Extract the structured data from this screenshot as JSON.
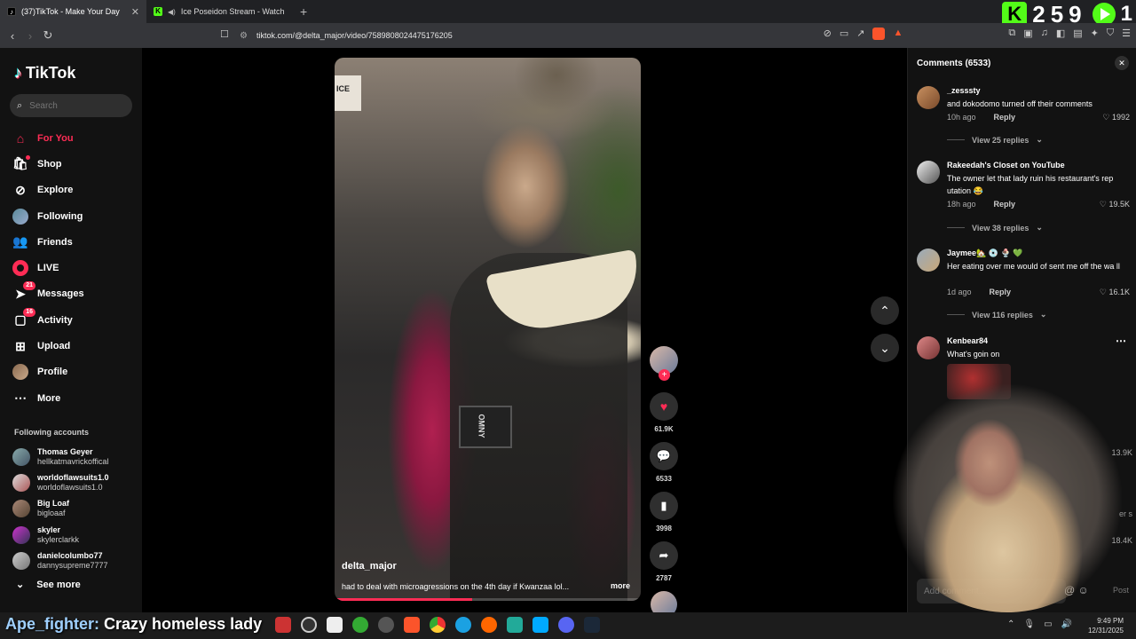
{
  "browser": {
    "tabs": [
      {
        "title": "(37)TikTok - Make Your Day",
        "favicon": "tiktok-icon",
        "active": true
      },
      {
        "title": "Ice Poseidon Stream - Watch Live",
        "favicon": "kick-icon",
        "active": false
      }
    ],
    "url": "tiktok.com/@delta_major/video/7589808024475176205"
  },
  "kick_overlay": {
    "number": "259",
    "viewers": "1"
  },
  "sidebar": {
    "logo": "TikTok",
    "search_placeholder": "Search",
    "items": [
      {
        "label": "For You",
        "icon": "home-icon",
        "active": true
      },
      {
        "label": "Shop",
        "icon": "shop-bag-icon"
      },
      {
        "label": "Explore",
        "icon": "compass-icon"
      },
      {
        "label": "Following",
        "icon": "following-avatar-icon"
      },
      {
        "label": "Friends",
        "icon": "friends-icon"
      },
      {
        "label": "LIVE",
        "icon": "live-icon"
      },
      {
        "label": "Messages",
        "icon": "paper-plane-icon",
        "badge": "21"
      },
      {
        "label": "Activity",
        "icon": "activity-icon",
        "badge": "16"
      },
      {
        "label": "Upload",
        "icon": "upload-icon"
      },
      {
        "label": "Profile",
        "icon": "profile-avatar-icon"
      },
      {
        "label": "More",
        "icon": "more-icon"
      }
    ],
    "following_header": "Following accounts",
    "following": [
      {
        "name": "Thomas Geyer",
        "handle": "hellkatmavrickoffical"
      },
      {
        "name": "worldoflawsuits1.0",
        "handle": "worldoflawsuits1.0"
      },
      {
        "name": "Big Loaf",
        "handle": "bigloaaf"
      },
      {
        "name": "skyler",
        "handle": "skylerclarkk"
      },
      {
        "name": "danielcolumbo77",
        "handle": "dannysupreme7777"
      }
    ],
    "see_more": "See more"
  },
  "video": {
    "author": "delta_major",
    "description": "had to deal with microagressions  on the 4th day if Kwanzaa lol...",
    "more": "more",
    "sign_text": "ICE",
    "camera_brand": "OMNY",
    "progress": 0.45,
    "likes": "61.9K",
    "comments": "6533",
    "saves": "3998",
    "shares": "2787"
  },
  "comments_panel": {
    "title": "Comments (6533)",
    "items": [
      {
        "user": "_zesssty",
        "text": "and dokodomo turned off their comments",
        "time": "10h ago",
        "reply": "Reply",
        "likes": "1992",
        "view_replies": "View 25 replies"
      },
      {
        "user": "Rakeedah's Closet on YouTube",
        "text": "The owner let that lady ruin his restaurant's rep utation 😂",
        "time": "18h ago",
        "reply": "Reply",
        "likes": "19.5K",
        "view_replies": "View 38 replies"
      },
      {
        "user": "Jaymee🏡 💿 🍨 💚",
        "text": "Her eating over me would of sent me off the wa ll",
        "time": "1d ago",
        "reply": "Reply",
        "likes": "16.1K",
        "view_replies": "View 116 replies"
      },
      {
        "user": "Kenbear84",
        "text": "What's goin on"
      }
    ],
    "side_likes": [
      "13.9K",
      "18.4K"
    ],
    "side_text": "er s",
    "add_comment_placeholder": "Add comment...",
    "post_label": "Post"
  },
  "stream_chat": {
    "user": "Ape_fighter:",
    "message": "Crazy homeless lady"
  },
  "taskbar": {
    "time": "9:49 PM",
    "date": "12/31/2025"
  }
}
